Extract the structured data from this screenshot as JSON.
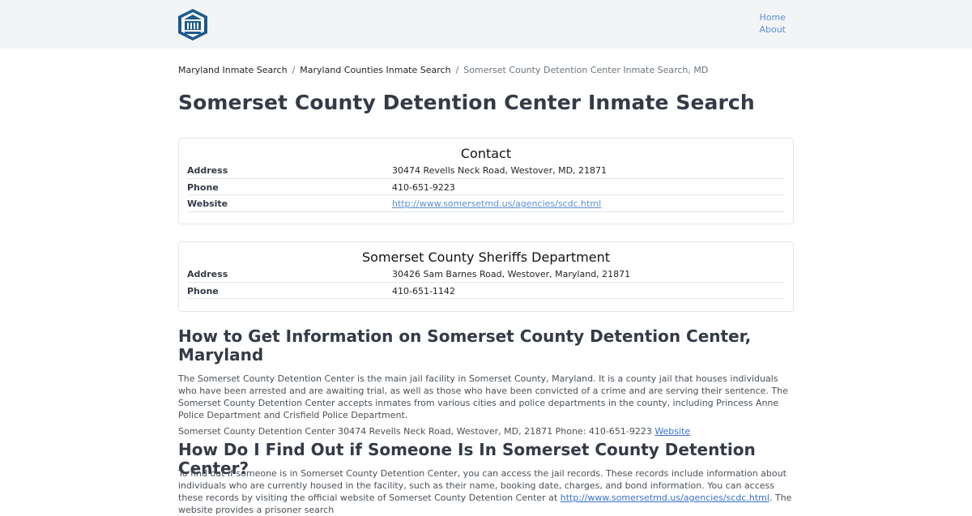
{
  "header": {
    "logo_icon": "jail-badge-icon",
    "nav": {
      "home": "Home",
      "about": "About"
    }
  },
  "breadcrumb": {
    "items": [
      "Maryland Inmate Search",
      "Maryland Counties Inmate Search"
    ],
    "separator": "/",
    "current": "Somerset County Detention Center Inmate Search, MD"
  },
  "page": {
    "title": "Somerset County Detention Center Inmate Search"
  },
  "contact": {
    "title": "Contact",
    "rows": [
      {
        "label": "Address",
        "value": "30474 Revells Neck Road, Westover, MD, 21871"
      },
      {
        "label": "Phone",
        "value": "410-651-9223"
      },
      {
        "label": "Website",
        "value": "http://www.somersetmd.us/agencies/scdc.html"
      }
    ]
  },
  "sheriff": {
    "title": "Somerset County Sheriffs Department",
    "rows": [
      {
        "label": "Address",
        "value": "30426 Sam Barnes Road, Westover, Maryland, 21871"
      },
      {
        "label": "Phone",
        "value": "410-651-1142"
      }
    ]
  },
  "section1": {
    "heading": "How to Get Information on Somerset County Detention Center, Maryland",
    "paragraph": "The Somerset County Detention Center is the main jail facility in Somerset County, Maryland. It is a county jail that houses individuals who have been arrested and are awaiting trial, as well as those who have been convicted of a crime and are serving their sentence. The Somerset County Detention Center accepts inmates from various cities and police departments in the county, including Princess Anne Police Department and Crisfield Police Department.",
    "summary": "Somerset County Detention Center 30474 Revells Neck Road, Westover, MD, 21871 Phone: 410-651-9223 ",
    "summary_link": "Website"
  },
  "section2": {
    "heading": "How Do I Find Out if Someone Is In Somerset County Detention Center?",
    "paragraph_start": "To find out if someone is in Somerset County Detention Center, you can access the jail records. These records include information about individuals who are currently housed in the facility, such as their name, booking date, charges, and bond information. You can access these records by visiting the official website of Somerset County Detention Center at ",
    "paragraph_link": "http://www.somersetmd.us/agencies/scdc.html",
    "paragraph_end": ". The website provides a prisoner search"
  },
  "colors": {
    "heading": "#343a46",
    "link": "#5b8fd6",
    "topbar": "#f3f4f6",
    "logo": "#1d5a8e"
  }
}
